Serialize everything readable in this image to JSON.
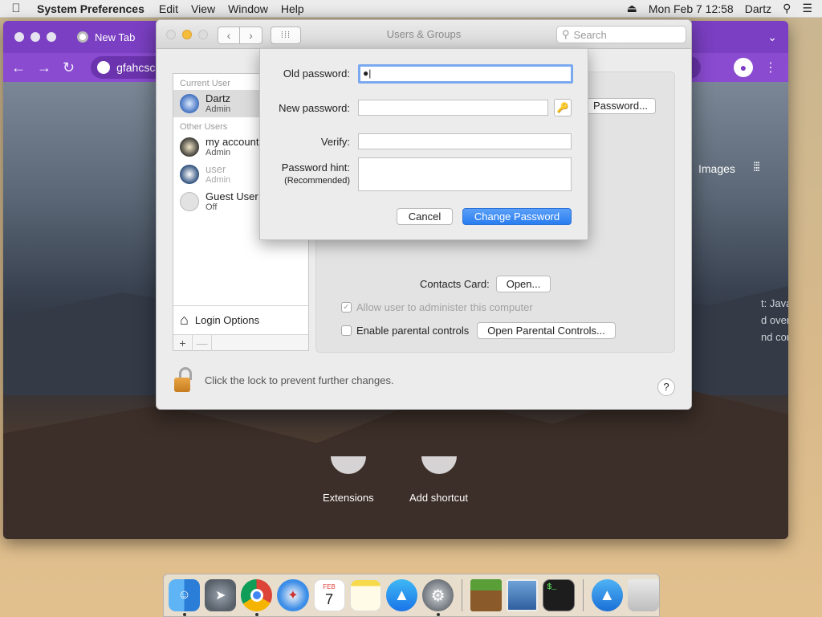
{
  "menubar": {
    "app_name": "System Preferences",
    "menus": [
      "Edit",
      "View",
      "Window",
      "Help"
    ],
    "datetime": "Mon Feb 7  12:58",
    "user": "Dartz"
  },
  "browser": {
    "tab_title": "New Tab",
    "address": "gfahcsc",
    "images_link": "Images",
    "side_text": [
      "t: Java",
      "d over",
      "nd con"
    ],
    "shortcuts": [
      "Extensions",
      "Add shortcut"
    ],
    "accent_color": "#7a3fc2"
  },
  "prefs": {
    "window_title": "Users & Groups",
    "search_placeholder": "Search",
    "current_user_label": "Current User",
    "other_users_label": "Other Users",
    "current_user": {
      "name": "Dartz",
      "role": "Admin"
    },
    "other_users": [
      {
        "name": "my account",
        "role": "Admin"
      },
      {
        "name": "user",
        "role": "Admin"
      },
      {
        "name": "Guest User",
        "role": "Off"
      }
    ],
    "login_options": "Login Options",
    "add_symbol": "+",
    "remove_symbol": "—",
    "reset_password_btn": "Password...",
    "contacts_card_label": "Contacts Card:",
    "open_btn": "Open...",
    "allow_admin_label": "Allow user to administer this computer",
    "parental_label": "Enable parental controls",
    "open_parental_btn": "Open Parental Controls...",
    "lock_text": "Click the lock to prevent further changes.",
    "help_symbol": "?"
  },
  "sheet": {
    "old_password_label": "Old password:",
    "old_password_value": "●|",
    "new_password_label": "New password:",
    "verify_label": "Verify:",
    "hint_label": "Password hint:",
    "hint_sublabel": "(Recommended)",
    "cancel_btn": "Cancel",
    "change_btn": "Change Password"
  },
  "dock": {
    "apps": [
      "Finder",
      "Launchpad",
      "Chrome",
      "Safari",
      "Calendar",
      "Notes",
      "App Store",
      "System Preferences",
      "Minecraft",
      "Preview",
      "Terminal",
      "Downloads",
      "Trash"
    ],
    "calendar_month": "FEB",
    "calendar_day": "7"
  }
}
